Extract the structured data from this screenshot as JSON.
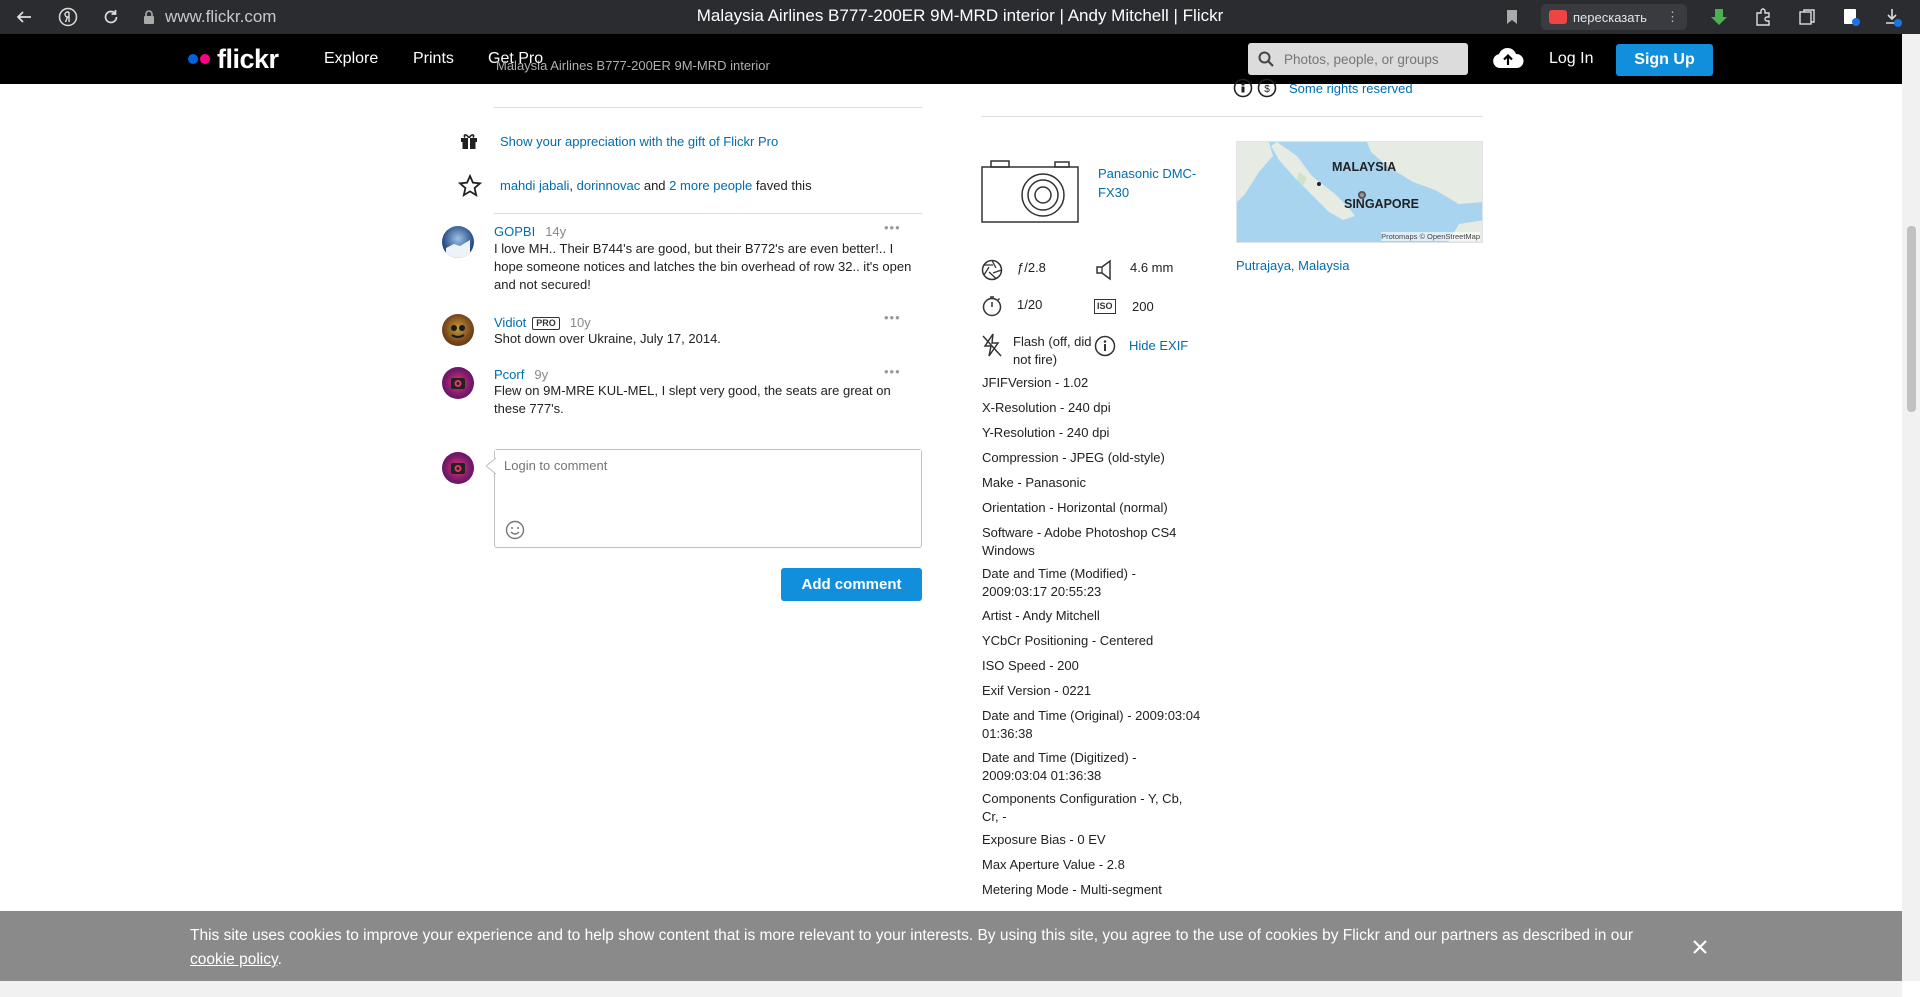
{
  "browser": {
    "url": "www.flickr.com",
    "window_title": "Malaysia Airlines B777-200ER 9M-MRD interior | Andy Mitchell | Flickr",
    "retell_label": "пересказать"
  },
  "nav": {
    "brand": "flickr",
    "links": [
      "Explore",
      "Prints",
      "Get Pro"
    ],
    "search_placeholder": "Photos, people, or groups",
    "login": "Log In",
    "signup": "Sign Up"
  },
  "header_peek": {
    "author": "Andy Mitchell",
    "photo_title": "Malaysia Airlines B777-200ER 9M-MRD interior",
    "license": "Some rights reserved"
  },
  "appreciation": {
    "gift_text": "Show your appreciation with the gift of Flickr Pro",
    "faves": {
      "user1": "mahdi jabali",
      "user2": "dorinnovac",
      "and": "and",
      "more": "2 more people",
      "suffix": "faved this"
    }
  },
  "comments": [
    {
      "name": "GOPBI",
      "age": "14y",
      "pro": false,
      "text": "I love MH.. Their B744's are good, but their B772's are even better!.. I hope someone notices and latches the bin overhead of row 32.. it's open and not secured!"
    },
    {
      "name": "Vidiot",
      "age": "10y",
      "pro": true,
      "pro_label": "PRO",
      "text": "Shot down over Ukraine, July 17, 2014."
    },
    {
      "name": "Pcorf",
      "age": "9y",
      "pro": false,
      "text": "Flew on 9M-MRE KUL-MEL, I slept very good, the seats are great on these 777's."
    }
  ],
  "comment_form": {
    "placeholder": "Login to comment",
    "submit": "Add comment"
  },
  "camera": {
    "model": "Panasonic DMC-FX30",
    "aperture": "ƒ/2.8",
    "focal_length": "4.6 mm",
    "shutter": "1/20",
    "iso_badge": "ISO",
    "iso": "200",
    "flash": "Flash (off, did not fire)",
    "hide_exif": "Hide EXIF"
  },
  "map": {
    "label1": "MALAYSIA",
    "label2": "SINGAPORE",
    "attribution": "Protomaps © OpenStreetMap",
    "location": "Putrajaya, Malaysia"
  },
  "exif": [
    "JFIFVersion - 1.02",
    "X-Resolution - 240 dpi",
    "Y-Resolution - 240 dpi",
    "Compression - JPEG (old-style)",
    "Make - Panasonic",
    "Orientation - Horizontal (normal)",
    "Software - Adobe Photoshop CS4 Windows",
    "Date and Time (Modified) - 2009:03:17 20:55:23",
    "Artist - Andy Mitchell",
    "YCbCr Positioning - Centered",
    "ISO Speed - 200",
    "Exif Version - 0221",
    "Date and Time (Original) - 2009:03:04 01:36:38",
    "Date and Time (Digitized) - 2009:03:04 01:36:38",
    "Components Configuration - Y, Cb, Cr, -",
    "Exposure Bias - 0 EV",
    "Max Aperture Value - 2.8",
    "Metering Mode - Multi-segment"
  ],
  "cookie": {
    "text": "This site uses cookies to improve your experience and to help show content that is more relevant to your interests. By using this site, you agree to the use of cookies by Flickr and our partners as described in our",
    "link": "cookie policy",
    "end": "."
  },
  "colors": {
    "link": "#006dac",
    "button": "#128fdc",
    "nav_bg": "#000000",
    "cookie_bg": "#8a8a8a"
  }
}
